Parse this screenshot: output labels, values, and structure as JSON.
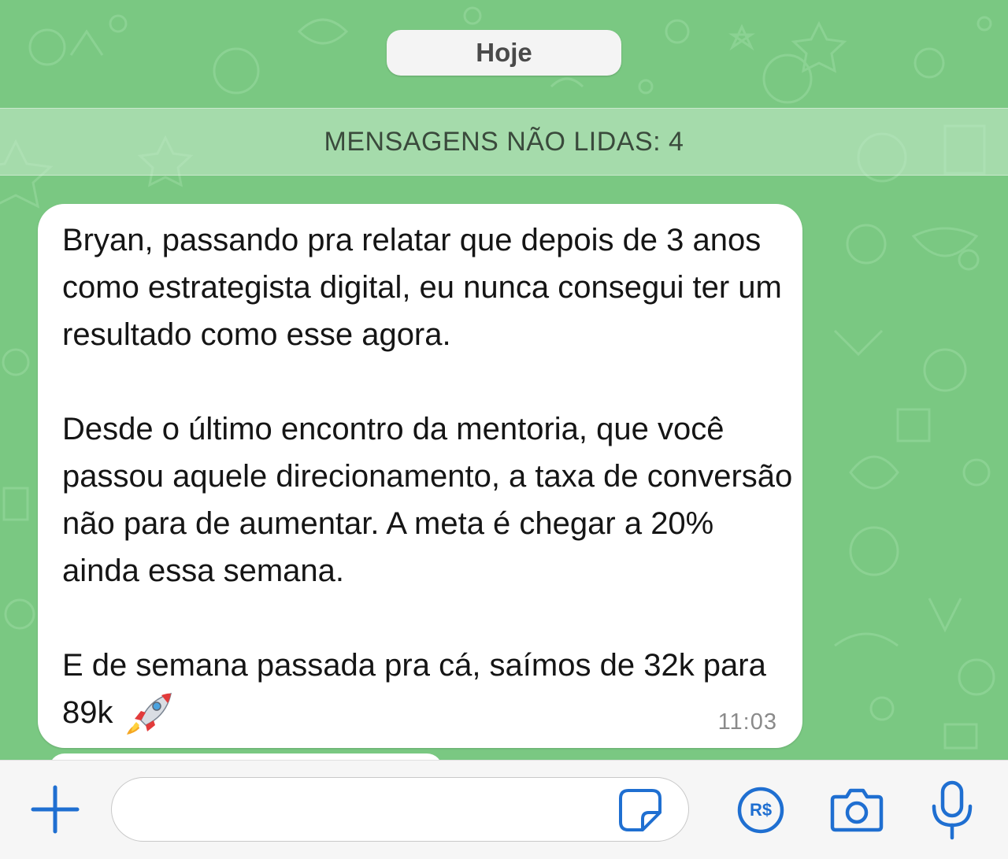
{
  "chat": {
    "date_label": "Hoje",
    "unread_label": "MENSAGENS NÃO LIDAS: 4"
  },
  "message": {
    "paragraph_1": "Bryan, passando pra relatar que depois de 3 anos como estrategista digital, eu nunca consegui ter um resultado como esse agora.",
    "paragraph_2": "Desde o último encontro da mentoria, que você passou aquele direcionamento, a taxa de conversão não para de aumentar. A meta é chegar a 20% ainda essa semana.",
    "paragraph_3": "E de semana passada pra cá, saímos de 32k para 89k",
    "emoji": "rocket",
    "time": "11:03"
  },
  "input_bar": {
    "placeholder": "",
    "pay_label": "R$",
    "icons": [
      "plus-icon",
      "sticker-icon",
      "pix-payment-icon",
      "camera-icon",
      "microphone-icon"
    ]
  },
  "colors": {
    "wallpaper": "#7ac882",
    "accent": "#1f6fd1",
    "bubble": "#ffffff"
  }
}
